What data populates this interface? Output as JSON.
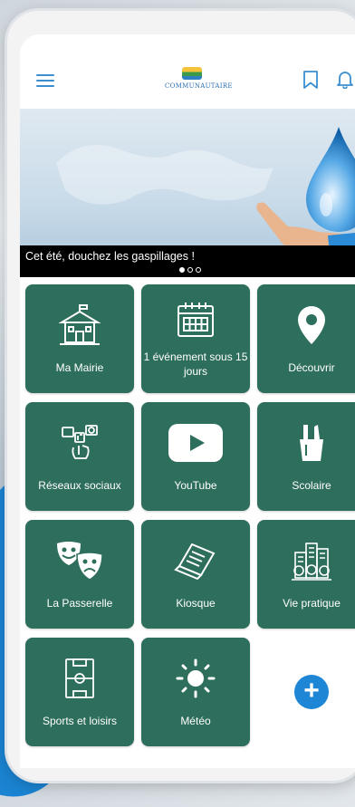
{
  "header": {
    "menu_icon": "hamburger-icon",
    "logo_text": "COMMUNAUTAIRE",
    "bookmark_icon": "bookmark-icon",
    "bell_icon": "bell-icon",
    "accent": "#3b8fd0"
  },
  "banner": {
    "caption": "Cet été, douchez les gaspillages !",
    "slides": 3,
    "active_slide": 1
  },
  "tiles": [
    {
      "label": "Ma Mairie",
      "icon": "town-hall-icon"
    },
    {
      "label": "1 événement sous 15 jours",
      "icon": "calendar-icon"
    },
    {
      "label": "Découvrir",
      "icon": "location-pin-icon"
    },
    {
      "label": "Réseaux sociaux",
      "icon": "social-network-icon"
    },
    {
      "label": "YouTube",
      "icon": "youtube-icon"
    },
    {
      "label": "Scolaire",
      "icon": "pencil-cup-icon"
    },
    {
      "label": "La Passerelle",
      "icon": "theater-masks-icon"
    },
    {
      "label": "Kiosque",
      "icon": "newspaper-icon"
    },
    {
      "label": "Vie pratique",
      "icon": "city-icon"
    },
    {
      "label": "Sports et loisirs",
      "icon": "sports-field-icon"
    },
    {
      "label": "Météo",
      "icon": "sun-icon"
    }
  ],
  "add_button": {
    "label": "+",
    "icon": "plus-icon"
  },
  "colors": {
    "tile": "#2e6e5c",
    "add": "#1f86d6"
  }
}
